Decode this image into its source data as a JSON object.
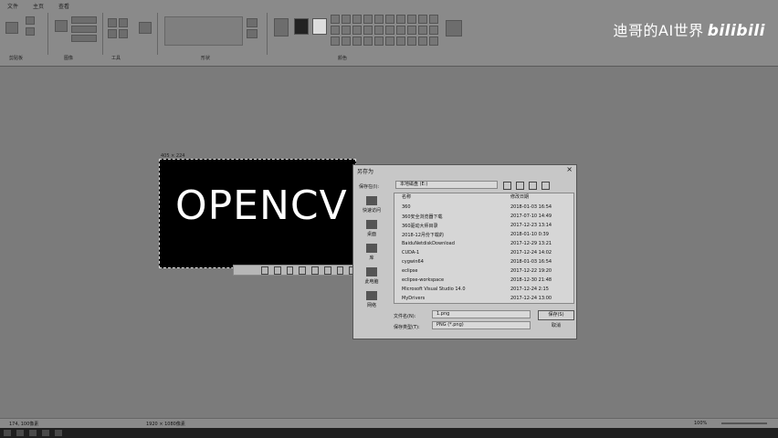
{
  "ribbon": {
    "tabs": [
      "文件",
      "主页",
      "查看"
    ],
    "groups": [
      "剪贴板",
      "图像",
      "工具",
      "形状",
      "颜色"
    ]
  },
  "watermark": {
    "text": "迪哥的AI世界",
    "brand": "bilibili"
  },
  "canvas": {
    "image_text": "OPENCV",
    "selection_size": "405 × 224"
  },
  "dialog": {
    "title": "另存为",
    "save_in_label": "保存在(I):",
    "save_in_value": "本地磁盘 (E:)",
    "places": [
      "快速访问",
      "桌面",
      "库",
      "此电脑",
      "网络"
    ],
    "col_name": "名称",
    "col_date": "修改日期",
    "files": [
      {
        "name": "360",
        "date": "2018-01-03 16:54"
      },
      {
        "name": "360安全浏览器下载",
        "date": "2017-07-10 14:49"
      },
      {
        "name": "360驱动大师目录",
        "date": "2017-12-23 13:14"
      },
      {
        "name": "2018-12月份下载的",
        "date": "2018-01-10 0:39"
      },
      {
        "name": "BaiduNetdiskDownload",
        "date": "2017-12-29 13:21"
      },
      {
        "name": "CUDA-1",
        "date": "2017-12-24 14:02"
      },
      {
        "name": "cygwin64",
        "date": "2018-01-03 16:54"
      },
      {
        "name": "eclipse",
        "date": "2017-12-22 19:20"
      },
      {
        "name": "eclipse-workspace",
        "date": "2018-12-30 21:48"
      },
      {
        "name": "Microsoft Visual Studio 14.0",
        "date": "2017-12-24 2:15"
      },
      {
        "name": "MyDrivers",
        "date": "2017-12-24 13:00"
      }
    ],
    "filename_label": "文件名(N):",
    "filename_value": "1.png",
    "filetype_label": "保存类型(T):",
    "filetype_value": "PNG (*.png)",
    "save_button": "保存(S)",
    "cancel_button": "取消"
  },
  "statusbar": {
    "coords": "174, 100像素",
    "size": "1920 × 1080像素",
    "zoom": "100%"
  }
}
